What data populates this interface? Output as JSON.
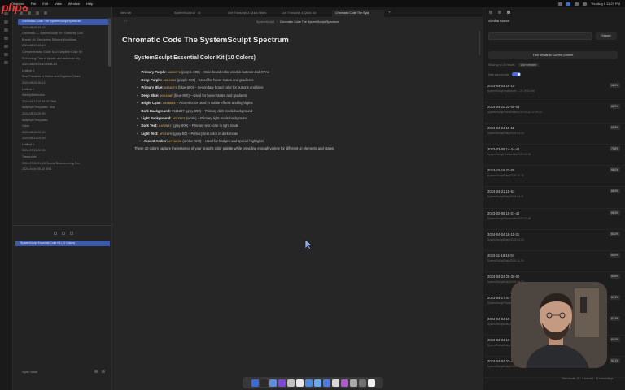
{
  "watermark": "php",
  "menubar": {
    "items": [
      "Obsidian",
      "File",
      "Edit",
      "View",
      "Window",
      "Help"
    ],
    "clock": "Thu Aug 8 11:27 PM"
  },
  "sidebar": {
    "files": [
      "Chromatic Code The SystemSculpt Spectrum",
      "2024-08-09 15-42",
      "Chromatic — SystemSculpt Kit · Branding Colo",
      "Branch 46: Structuring Efficient Workflows",
      "2024-08-09 15-10",
      "Comprehensive Guide to a Complete Color Ke",
      "Refreshing Plan to Update and Automate My",
      "2024-08-09 09-10 MAB-4G",
      "Untitled 3",
      "Best Practices to Refine and Organize Obsid",
      "2024-08-04 05-12",
      "Untitled 2",
      "WeeklyReflection",
      "2024-04-11 10-58-36 SNB",
      "dailyNoteTemplates - test",
      "2024-08-01 09-30",
      "dailyNoteTemplates",
      "Clean",
      "2024-08-03 09-30",
      "2024-06-21 09-30",
      "Untitled 1",
      "2024-07-31 09-30",
      "Transcripts",
      "2024-07-26 21-18 Crucial Brainstorming Ses",
      "2024-xx-xx 09-30 SNB"
    ],
    "pinned": "Pinned",
    "search_selected": "SystemSculpt Essential Color Kit (10 Colors)",
    "vault": "Sync Vault"
  },
  "tabs": [
    "New tab",
    "SystemSculpt AI · AI",
    "Live Transcript & Quick Notes",
    "Live Transcript & Quick No",
    "Chromatic Code The Syst"
  ],
  "breadcrumb": {
    "parent": "SystemSculpt",
    "current": "Chromatic Code The SystemSculpt Spectrum"
  },
  "note": {
    "title": "Chromatic Code The SystemSculpt Spectrum",
    "heading": "SystemSculpt Essential Color Kit (10 Colors)",
    "colors": [
      {
        "name": "Primary Purple:",
        "code": "#8B5CF6",
        "text": "(purple-600) – Main brand color used in buttons and CTAs"
      },
      {
        "name": "Deep Purple:",
        "code": "#6D28D9",
        "text": "(purple-800) – Used for hover states and gradients"
      },
      {
        "name": "Primary Blue:",
        "code": "#3B82F6",
        "text": "(blue-600) – Secondary brand color for buttons and links"
      },
      {
        "name": "Deep Blue:",
        "code": "#1E40AF",
        "text": "(blue-800) – Used for hover states and gradients"
      },
      {
        "name": "Bright Cyan:",
        "code": "#06B6D4",
        "text": "– Accent color used in subtle effects and highlights"
      },
      {
        "name": "Dark Background:",
        "code": "",
        "text": "#111827 (gray-900) – Primary dark mode background"
      },
      {
        "name": "Light Background:",
        "code": "#FFFFFF",
        "text": "(white) – Primary light mode background"
      },
      {
        "name": "Dark Text:",
        "code": "#1F2937",
        "text": "(gray-800) – Primary text color in light mode"
      },
      {
        "name": "Light Text:",
        "code": "#F9FAFB",
        "text": "(gray-50) – Primary text color in dark mode"
      },
      {
        "name": "Accent Amber:",
        "code": "#F59E0B",
        "text": "(amber-500) – Used for badges and special highlights"
      }
    ],
    "paragraph": "These 10 colors capture the essence of your brand's color palette while providing enough variety for different UI elements and states."
  },
  "right_panel": {
    "title": "Similar Notes",
    "search_button": "Search",
    "find_button": "Find Similar to Current Content",
    "option1": "Show up to 20 results",
    "option1_btn": "Use selected",
    "option2": "Hide current note",
    "results": [
      {
        "title": "2024-04-04 19-10",
        "snippet": "SystemSculpt brainstorm ... 24 19-10.md",
        "score": "66.5%"
      },
      {
        "title": "2024-04-10 22-09-03",
        "snippet": "SystemSculpt/Transcripts/2024-04-10 22-09-03",
        "score": "62.9%"
      },
      {
        "title": "2024-04-24 18-11",
        "snippet": "SystemSculpt/Daily/2024-04-24",
        "score": "61.9%"
      },
      {
        "title": "2023-03-08 14-44-44",
        "snippet": "SystemSculpt/Transcripts/2023-03-08",
        "score": "70.8%"
      },
      {
        "title": "2024-10-16 23-08",
        "snippet": "SystemSculpt/Daily/2024-10-16",
        "score": "66.0%"
      },
      {
        "title": "2024-04-21 15-53",
        "snippet": "SystemSculpt/Daily/2024-04-21",
        "score": "66.3%"
      },
      {
        "title": "2023-02-08 15-01-42",
        "snippet": "SystemSculpt/Transcripts/2023-02-08",
        "score": "66.3%"
      },
      {
        "title": "2024-04-04 18-11-31",
        "snippet": "SystemSculpt/Daily/2024-04-04",
        "score": "60.2%"
      },
      {
        "title": "2024-11-18 16-57",
        "snippet": "SystemSculpt/Daily/2024-11-18",
        "score": "60.0%"
      },
      {
        "title": "2024-04-24 20-30-00",
        "snippet": "SystemSculpt/Daily/2024-04-24",
        "score": "60.6%"
      },
      {
        "title": "2023-04-17 01-10",
        "snippet": "SystemSculpt/Transcripts/2023-04-17",
        "score": "60.3%"
      },
      {
        "title": "2024-04-04 19-4",
        "snippet": "SystemSculpt/Daily/2024-04-04",
        "score": "60.3%"
      },
      {
        "title": "2024-04-04 19-3",
        "snippet": "SystemSculpt/Daily/2024-04-04",
        "score": "60.2%"
      },
      {
        "title": "2024-04-04 22-40",
        "snippet": "SystemSculpt/Daily/2024-04-04",
        "score": "60.1%"
      }
    ],
    "footer": "Total results: 20 · 0 indexed · 21 embeddings"
  },
  "dock_colors": [
    "#3a6ad6",
    "#2b2b2b",
    "#5a8fe0",
    "#7a4ad0",
    "#c0c0c0",
    "#e9e9e9",
    "#4b8ae0",
    "#6fa8e8",
    "#4e7be0",
    "#d9d9d9",
    "#b05ad0",
    "#aaaaaa",
    "#707070",
    "#f0f0f0"
  ]
}
